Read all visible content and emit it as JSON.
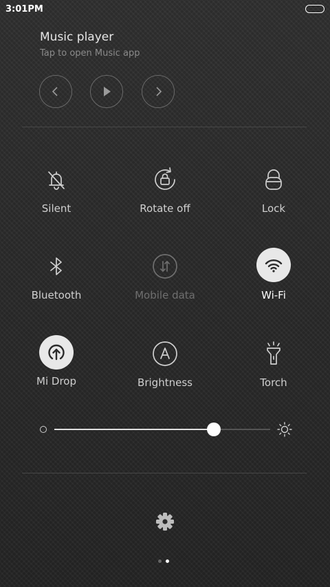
{
  "status_bar": {
    "time": "3:01PM",
    "battery_icon": "battery-full-icon"
  },
  "music_player": {
    "title": "Music player",
    "subtitle": "Tap to open Music app",
    "controls": [
      "previous-icon",
      "play-icon",
      "next-icon"
    ]
  },
  "toggles": [
    {
      "label": "Silent",
      "icon": "bell-off-icon",
      "state": "off"
    },
    {
      "label": "Rotate off",
      "icon": "rotation-lock-icon",
      "state": "off"
    },
    {
      "label": "Lock",
      "icon": "lock-icon",
      "state": "off"
    },
    {
      "label": "Bluetooth",
      "icon": "bluetooth-icon",
      "state": "off"
    },
    {
      "label": "Mobile data",
      "icon": "mobile-data-icon",
      "state": "disabled"
    },
    {
      "label": "Wi-Fi",
      "icon": "wifi-icon",
      "state": "on"
    },
    {
      "label": "Mi Drop",
      "icon": "mi-drop-icon",
      "state": "on"
    },
    {
      "label": "Brightness",
      "icon": "auto-brightness-icon",
      "state": "off"
    },
    {
      "label": "Torch",
      "icon": "torch-icon",
      "state": "off"
    }
  ],
  "brightness_slider": {
    "value": 0.74,
    "min_icon": "brightness-low-icon",
    "max_icon": "brightness-high-icon"
  },
  "footer": {
    "settings_icon": "gear-icon",
    "page_count": 2,
    "active_page": 2
  },
  "colors": {
    "active_tile_bg": "#e8e8e8",
    "active_icon": "#2a2a2a",
    "inactive_icon": "#cfcfcf",
    "disabled": "#6f6f6f"
  }
}
